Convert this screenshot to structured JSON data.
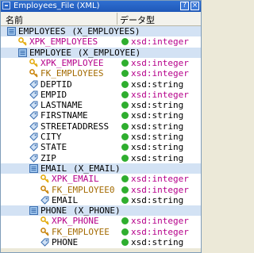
{
  "window": {
    "title": "Employees_File (XML)",
    "help_btn": "?",
    "close_btn": "×"
  },
  "header": {
    "name": "名前",
    "type": "データ型"
  },
  "rows": [
    {
      "label": "EMPLOYEES",
      "ann": "(X_EMPLOYEES)",
      "type": "",
      "indent": 0,
      "kind": "elem",
      "hl": true
    },
    {
      "label": "XPK_EMPLOYEES",
      "ann": "",
      "type": "xsd:integer",
      "indent": 1,
      "kind": "pk",
      "hl": false
    },
    {
      "label": "EMPLOYEE",
      "ann": "(X_EMPLOYEE)",
      "type": "",
      "indent": 1,
      "kind": "elem",
      "hl": true
    },
    {
      "label": "XPK_EMPLOYEE",
      "ann": "",
      "type": "xsd:integer",
      "indent": 2,
      "kind": "pk",
      "hl": false
    },
    {
      "label": "FK_EMPLOYEES",
      "ann": "",
      "type": "xsd:integer",
      "indent": 2,
      "kind": "fk",
      "hl": false
    },
    {
      "label": "DEPTID",
      "ann": "",
      "type": "xsd:string",
      "indent": 2,
      "kind": "attr",
      "hl": false
    },
    {
      "label": "EMPID",
      "ann": "",
      "type": "xsd:integer",
      "indent": 2,
      "kind": "attr",
      "hl": false
    },
    {
      "label": "LASTNAME",
      "ann": "",
      "type": "xsd:string",
      "indent": 2,
      "kind": "attr",
      "hl": false
    },
    {
      "label": "FIRSTNAME",
      "ann": "",
      "type": "xsd:string",
      "indent": 2,
      "kind": "attr",
      "hl": false
    },
    {
      "label": "STREETADDRESS",
      "ann": "",
      "type": "xsd:string",
      "indent": 2,
      "kind": "attr",
      "hl": false
    },
    {
      "label": "CITY",
      "ann": "",
      "type": "xsd:string",
      "indent": 2,
      "kind": "attr",
      "hl": false
    },
    {
      "label": "STATE",
      "ann": "",
      "type": "xsd:string",
      "indent": 2,
      "kind": "attr",
      "hl": false
    },
    {
      "label": "ZIP",
      "ann": "",
      "type": "xsd:string",
      "indent": 2,
      "kind": "attr",
      "hl": false
    },
    {
      "label": "EMAIL",
      "ann": "(X_EMAIL)",
      "type": "",
      "indent": 2,
      "kind": "elem",
      "hl": true
    },
    {
      "label": "XPK_EMAIL",
      "ann": "",
      "type": "xsd:integer",
      "indent": 3,
      "kind": "pk",
      "hl": false
    },
    {
      "label": "FK_EMPLOYEE0",
      "ann": "",
      "type": "xsd:integer",
      "indent": 3,
      "kind": "fk",
      "hl": false
    },
    {
      "label": "EMAIL",
      "ann": "",
      "type": "xsd:string",
      "indent": 3,
      "kind": "attr",
      "hl": false
    },
    {
      "label": "PHONE",
      "ann": "(X_PHONE)",
      "type": "",
      "indent": 2,
      "kind": "elem",
      "hl": true
    },
    {
      "label": "XPK_PHONE",
      "ann": "",
      "type": "xsd:integer",
      "indent": 3,
      "kind": "pk",
      "hl": false
    },
    {
      "label": "FK_EMPLOYEE",
      "ann": "",
      "type": "xsd:integer",
      "indent": 3,
      "kind": "fk",
      "hl": false
    },
    {
      "label": "PHONE",
      "ann": "",
      "type": "xsd:string",
      "indent": 3,
      "kind": "attr",
      "hl": false
    }
  ]
}
